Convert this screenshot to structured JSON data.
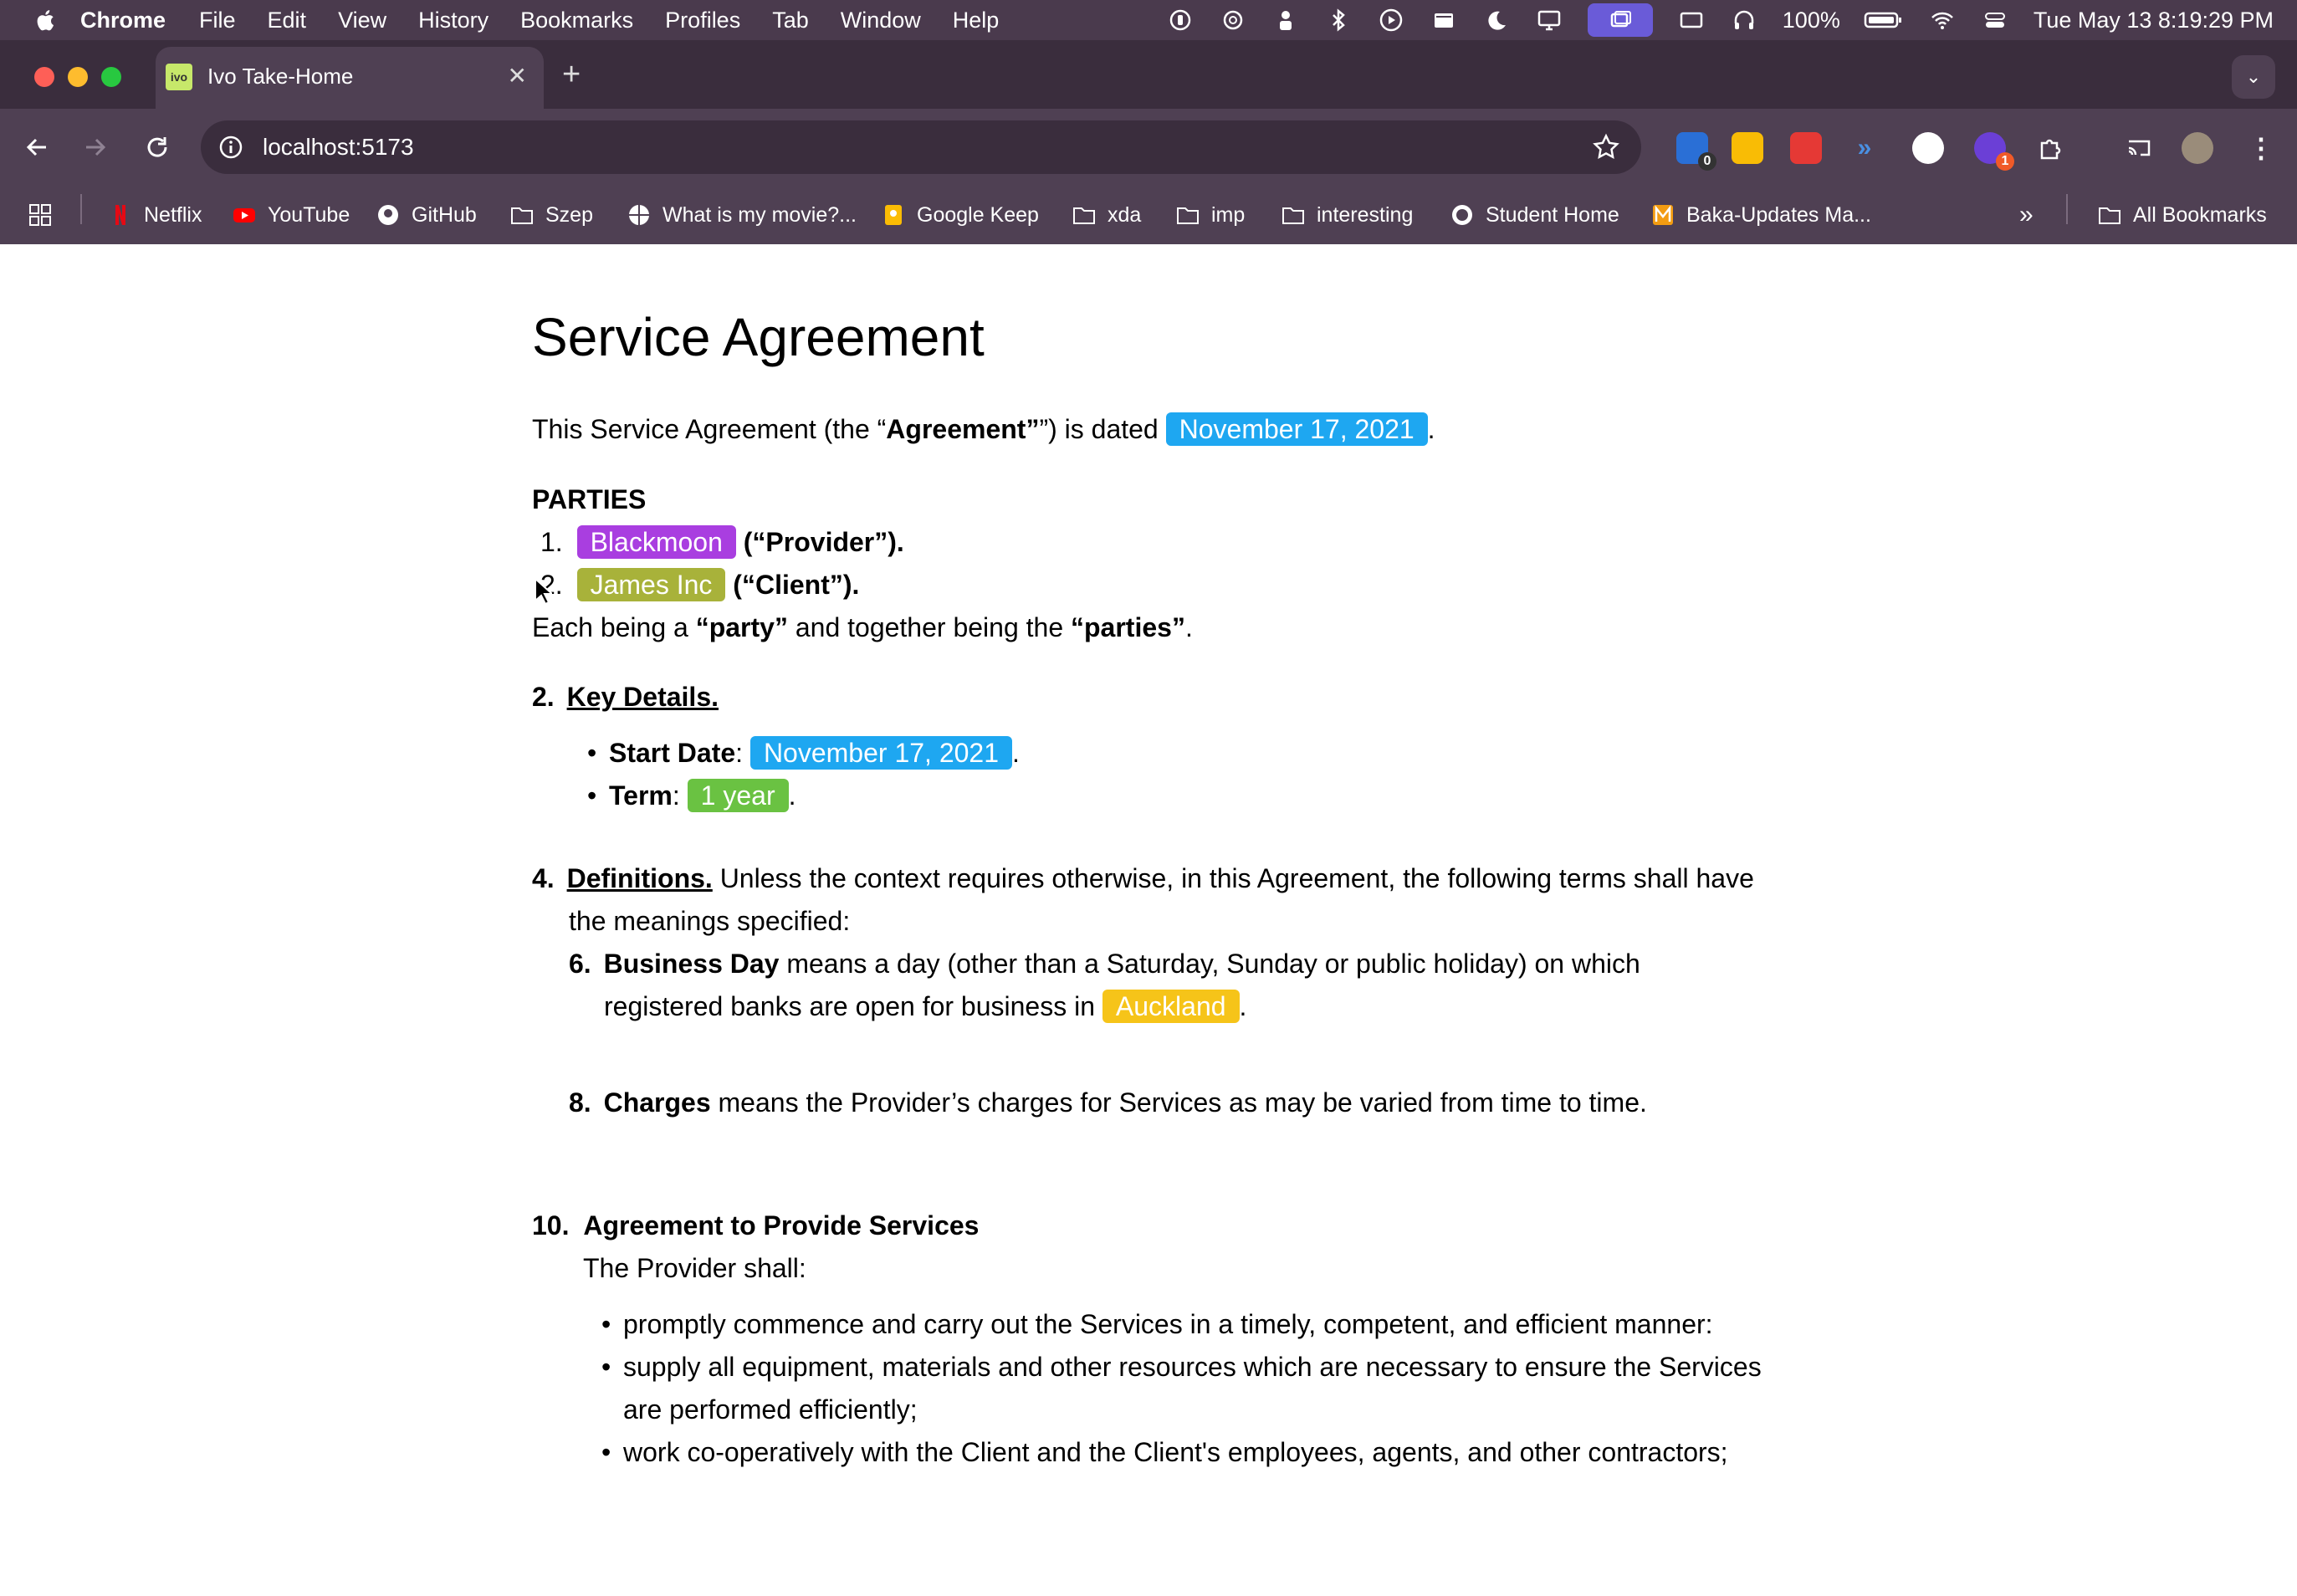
{
  "menubar": {
    "app": "Chrome",
    "items": [
      "File",
      "Edit",
      "View",
      "History",
      "Bookmarks",
      "Profiles",
      "Tab",
      "Window",
      "Help"
    ],
    "battery": "100%",
    "datetime": "Tue May 13  8:19:29 PM"
  },
  "tab": {
    "title": "Ivo Take-Home",
    "favicon_text": "ivo"
  },
  "omnibox": {
    "url": "localhost:5173"
  },
  "extensions": {
    "badge_1": "0",
    "badge_2": "1"
  },
  "bookmarks": {
    "items": [
      "Netflix",
      "YouTube",
      "GitHub",
      "Szep",
      "What is my movie?...",
      "Google Keep",
      "xda",
      "imp",
      "interesting",
      "Student Home",
      "Baka-Updates Ma..."
    ],
    "all": "All Bookmarks"
  },
  "colors": {
    "date_tag": "#1ea7f1",
    "provider_tag": "#a93ee0",
    "client_tag": "#a8b23a",
    "term_tag": "#6ac242",
    "location_tag": "#f6c419"
  },
  "document": {
    "title": "Service Agreement",
    "intro_pre": "This Service Agreement  (the “",
    "intro_term": "Agreement",
    "intro_mid": "”) is dated ",
    "intro_date": "November 17, 2021",
    "parties_heading": "PARTIES",
    "party1_num": "1.",
    "party1_name": "Blackmoon",
    "party1_role": "(“Provider”).",
    "party2_num": "2.",
    "party2_name": "James Inc",
    "party2_role": "(“Client”).",
    "each_pre": "Each being a ",
    "each_party": "“party”",
    "each_mid": " and together being the ",
    "each_parties": "“parties”",
    "s2_num": "2.",
    "s2_title": "Key Details.",
    "start_label": "Start Date",
    "start_value": "November 17, 2021",
    "term_label": "Term",
    "term_value": "1 year",
    "s4_num": "4.",
    "s4_title": "Definitions.",
    "s4_text1": " Unless the context requires otherwise, in this Agreement, the following terms shall have",
    "s4_text2": "the meanings specified:",
    "d6_num": "6.",
    "d6_term": "Business Day",
    "d6_text1": " means a day (other than a Saturday, Sunday or public holiday) on which",
    "d6_text2": "registered banks are open for business in ",
    "d6_location": "Auckland",
    "d8_num": "8.",
    "d8_term": "Charges",
    "d8_text": " means the Provider’s charges for Services as may be varied from time to time.",
    "s10_num": "10.",
    "s10_title": "Agreement to Provide Services",
    "s10_intro": "The Provider shall:",
    "s10_b1": "promptly commence and carry out the Services in a timely, competent, and efficient manner:",
    "s10_b2a": "supply all equipment, materials and other resources which are necessary to ensure the Services",
    "s10_b2b": "are performed efficiently;",
    "s10_b3": "work co-operatively with the Client and the Client's employees, agents, and other contractors;"
  }
}
